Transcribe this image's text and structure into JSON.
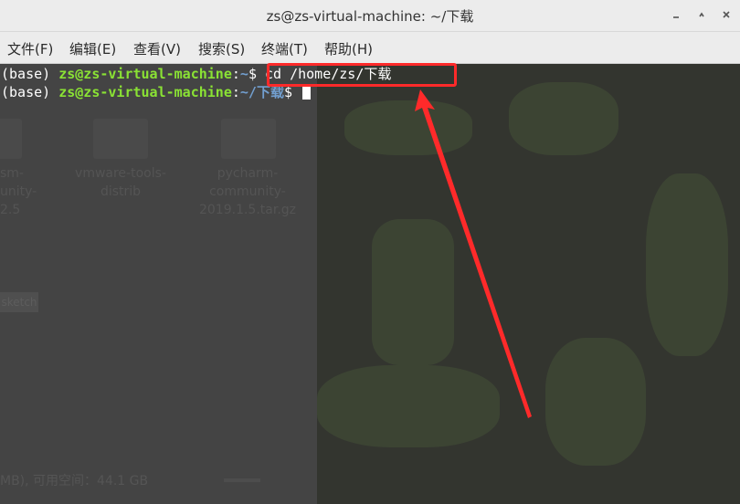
{
  "window": {
    "title": "zs@zs-virtual-machine: ~/下载",
    "controls": {
      "minimize_icon": "minimize-icon",
      "maximize_icon": "maximize-icon",
      "close_icon": "close-icon"
    }
  },
  "menu": {
    "items": [
      {
        "label": "文件(F)"
      },
      {
        "label": "编辑(E)"
      },
      {
        "label": "查看(V)"
      },
      {
        "label": "搜索(S)"
      },
      {
        "label": "终端(T)"
      },
      {
        "label": "帮助(H)"
      }
    ]
  },
  "terminal": {
    "lines": [
      {
        "env": "(base) ",
        "userhost": "zs@zs-virtual-machine",
        "sep": ":",
        "path": "~",
        "prompt": "$ ",
        "command": "cd /home/zs/下载"
      },
      {
        "env": "(base) ",
        "userhost": "zs@zs-virtual-machine",
        "sep": ":",
        "path": "~/下载",
        "prompt": "$ ",
        "command": ""
      }
    ]
  },
  "background": {
    "files": [
      {
        "name_lines": [
          "sm-",
          "unity-",
          "2.5"
        ]
      },
      {
        "name_lines": [
          "vmware-tools-",
          "distrib"
        ]
      },
      {
        "name_lines": [
          "pycharm-",
          "community-",
          "2019.1.5.tar.gz"
        ]
      }
    ],
    "tag": "sketch",
    "status": "MB), 可用空间：44.1 GB"
  },
  "annotation": {
    "box_color": "#ff2a2a",
    "arrow_color": "#ff2a2a"
  },
  "colors": {
    "userhost": "#8ae234",
    "path": "#729fcf",
    "text": "#ffffff"
  }
}
